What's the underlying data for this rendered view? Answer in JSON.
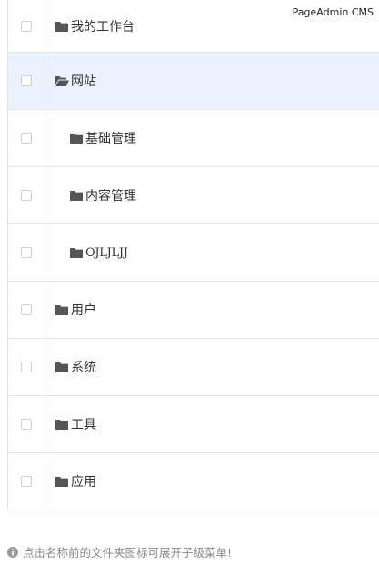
{
  "brand": "PageAdmin CMS",
  "rows": [
    {
      "label": "我的工作台",
      "level": 1,
      "open": false,
      "active": false
    },
    {
      "label": "网站",
      "level": 1,
      "open": true,
      "active": true
    },
    {
      "label": "基础管理",
      "level": 2,
      "open": false,
      "active": false
    },
    {
      "label": "内容管理",
      "level": 2,
      "open": false,
      "active": false
    },
    {
      "label": "OJLJLJJ",
      "level": 2,
      "open": false,
      "active": false
    },
    {
      "label": "用户",
      "level": 1,
      "open": false,
      "active": false
    },
    {
      "label": "系统",
      "level": 1,
      "open": false,
      "active": false
    },
    {
      "label": "工具",
      "level": 1,
      "open": false,
      "active": false
    },
    {
      "label": "应用",
      "level": 1,
      "open": false,
      "active": false
    }
  ],
  "hint": "点击名称前的文件夹图标可展开子级菜单!",
  "colors": {
    "active_row": "#e9f2fd",
    "folder": "#555555",
    "hint": "#8a8a8a"
  }
}
